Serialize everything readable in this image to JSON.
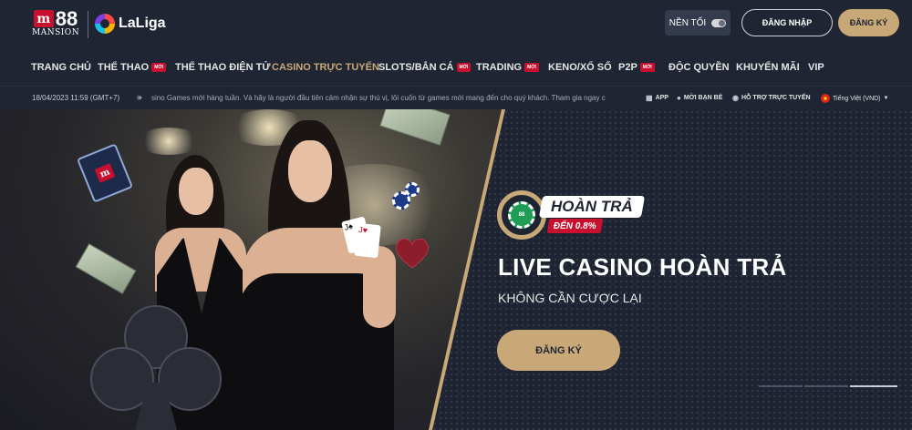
{
  "header": {
    "logo_brand": "88",
    "logo_sub": "MANSION",
    "partner_logo": "LaLiga",
    "theme_toggle_label": "NỀN TỐI",
    "login_label": "ĐĂNG NHẬP",
    "register_label": "ĐĂNG KÝ"
  },
  "nav": {
    "items": [
      {
        "label": "TRANG CHỦ",
        "badge": ""
      },
      {
        "label": "THỂ THAO",
        "badge": "MỚI"
      },
      {
        "label": "THỂ THAO ĐIỆN TỬ",
        "badge": ""
      },
      {
        "label": "CASINO TRỰC TUYẾN",
        "badge": "",
        "active": true
      },
      {
        "label": "SLOTS/BẮN CÁ",
        "badge": "MỚI"
      },
      {
        "label": "TRADING",
        "badge": "MỚI"
      },
      {
        "label": "KENO/XỔ SỐ",
        "badge": ""
      },
      {
        "label": "P2P",
        "badge": "MỚI"
      },
      {
        "label": "ĐỘC QUYỀN",
        "badge": ""
      },
      {
        "label": "KHUYẾN MÃI",
        "badge": ""
      },
      {
        "label": "VIP",
        "badge": ""
      }
    ],
    "active_color": "#c9a877"
  },
  "ticker": {
    "datetime": "18/04/2023 11:59 (GMT+7)",
    "message": "sino Games mới hàng tuần. Và hãy là người đầu tiên cảm nhận sự thú vị, lôi cuốn từ games mới mang đến cho quý khách. Tham gia ngay c",
    "links": {
      "app": "APP",
      "invite": "MỜI BẠN BÈ",
      "support": "HỖ TRỢ TRỰC TUYẾN",
      "language": "Tiếng Việt (VND)"
    }
  },
  "banner": {
    "badge_title": "HOÀN TRẢ",
    "badge_sub": "ĐẾN 0.8%",
    "chip_label": "88",
    "title": "LIVE CASINO HOÀN TRẢ",
    "subtitle": "KHÔNG CẦN CƯỢC LẠI",
    "cta": "ĐĂNG KÝ",
    "slide_count": 3,
    "active_slide": 3
  },
  "colors": {
    "background": "#1e2432",
    "accent_gold": "#c9a877",
    "brand_red": "#c8102e"
  }
}
